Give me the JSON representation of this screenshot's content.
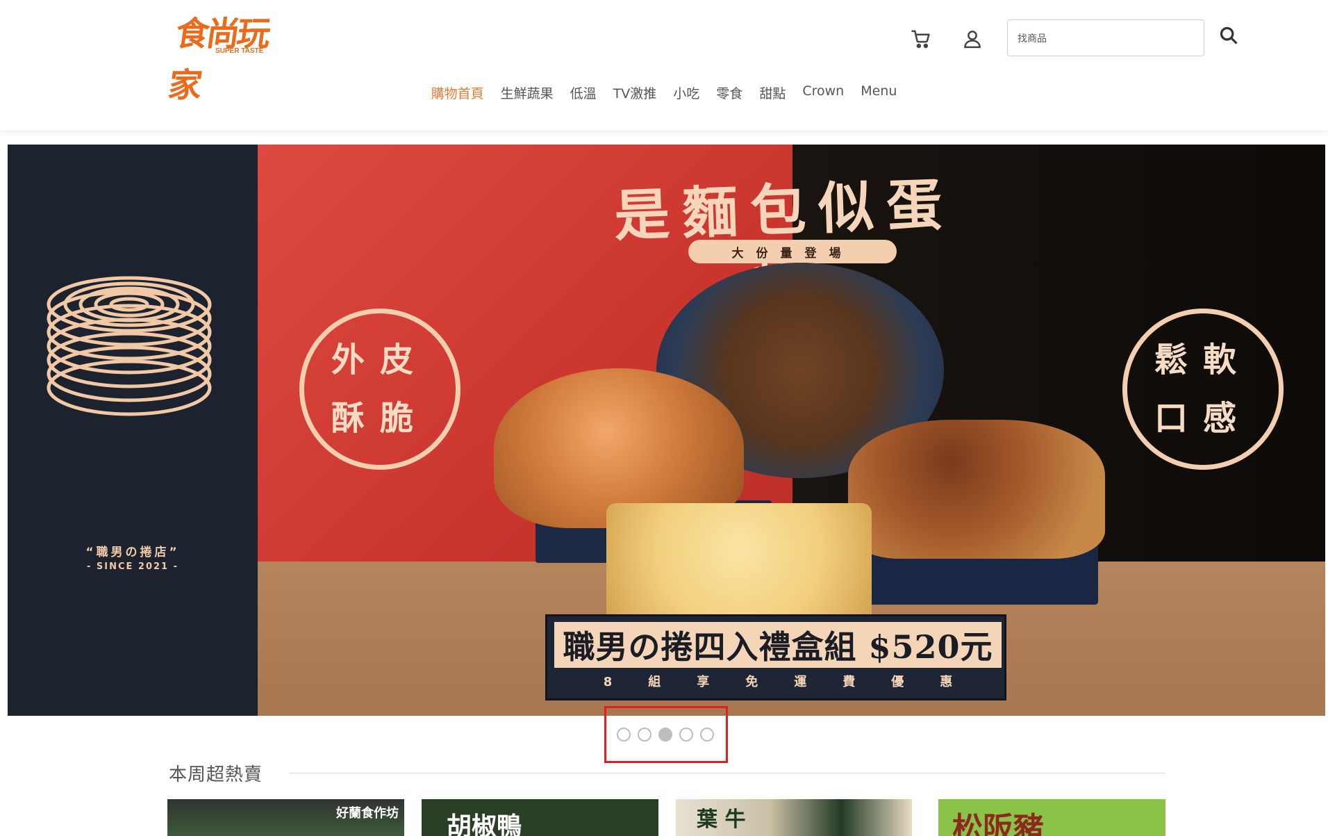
{
  "header": {
    "logo_text": "食尚玩家",
    "logo_sub": "SUPER TASTE",
    "search_placeholder": "找商品"
  },
  "nav": {
    "items": [
      {
        "label": "購物首頁",
        "active": true
      },
      {
        "label": "生鮮蔬果",
        "active": false
      },
      {
        "label": "低溫",
        "active": false
      },
      {
        "label": "TV激推",
        "active": false
      },
      {
        "label": "小吃",
        "active": false
      },
      {
        "label": "零食",
        "active": false
      },
      {
        "label": "甜點",
        "active": false
      },
      {
        "label": "Crown",
        "active": false
      },
      {
        "label": "Menu",
        "active": false
      }
    ]
  },
  "banner": {
    "brand": "“職男の捲店”",
    "since": "- SINCE 2021 -",
    "headline": "是麵包似蛋糕",
    "sub_pill": "大份量登場",
    "badge_left": [
      "外皮",
      "酥脆"
    ],
    "badge_right": [
      "鬆軟",
      "口感"
    ],
    "promo_title": "職男の捲四入禮盒組 $520元",
    "promo_sub": "8組享免運費優惠",
    "slide_count": 5,
    "active_slide": 3
  },
  "hot_section": {
    "title": "本周超熱賣",
    "cards": [
      {
        "text": "好蘭食作坊"
      },
      {
        "text": "胡椒鴨"
      },
      {
        "text": "葉  牛"
      },
      {
        "text": "松阪豬"
      }
    ]
  },
  "colors": {
    "accent": "#ec7a35",
    "logo": "#ec6a1c",
    "highlight_frame": "#e02020"
  },
  "icons": {
    "cart": "cart-icon",
    "user": "user-icon",
    "search": "search-icon"
  }
}
